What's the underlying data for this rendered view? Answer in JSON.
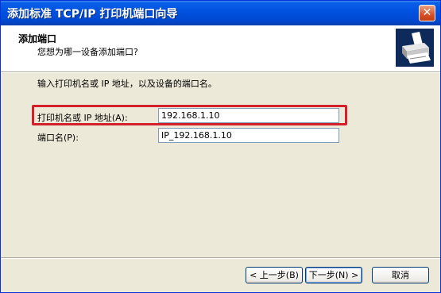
{
  "window": {
    "title": "添加标准 TCP/IP 打印机端口向导",
    "close_glyph": "✕"
  },
  "header": {
    "title": "添加端口",
    "subtitle": "您想为哪一设备添加端口?",
    "icon": "printer-icon"
  },
  "content": {
    "instruction": "输入打印机名或 IP 地址，以及设备的端口名。",
    "printer_name_label": "打印机名或 IP 地址(A):",
    "printer_name_value": "192.168.1.10",
    "port_name_label": "端口名(P):",
    "port_name_value": "IP_192.168.1.10"
  },
  "buttons": {
    "back": "< 上一步(B)",
    "next": "下一步(N) >",
    "cancel": "取消"
  },
  "colors": {
    "highlight": "#d3202a",
    "titlebar": "#0053e1"
  }
}
